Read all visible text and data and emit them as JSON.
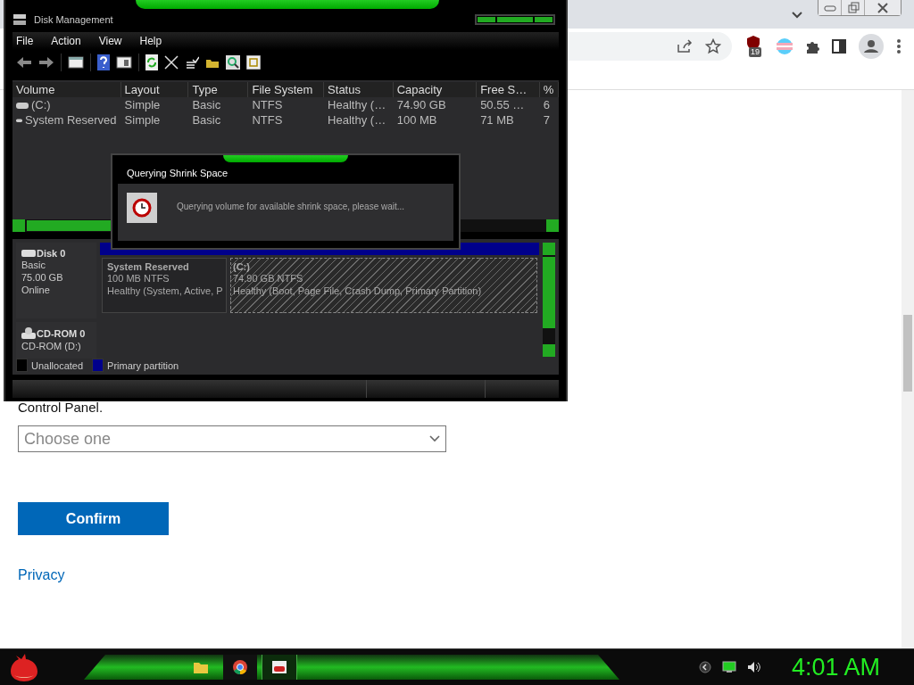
{
  "browser": {
    "extension_badge": "19"
  },
  "page": {
    "text": "Control Panel.",
    "select": {
      "placeholder": "Choose one"
    },
    "confirm_button": "Confirm",
    "privacy_link": "Privacy"
  },
  "disk_management": {
    "title": "Disk Management",
    "menu": [
      "File",
      "Action",
      "View",
      "Help"
    ],
    "columns": [
      "Volume",
      "Layout",
      "Type",
      "File System",
      "Status",
      "Capacity",
      "Free S…",
      "%"
    ],
    "rows": [
      {
        "cells": [
          "(C:)",
          "Simple",
          "Basic",
          "NTFS",
          "Healthy (…",
          "74.90 GB",
          "50.55 …",
          "6"
        ]
      },
      {
        "cells": [
          "System Reserved",
          "Simple",
          "Basic",
          "NTFS",
          "Healthy (…",
          "100 MB",
          "71 MB",
          "7"
        ]
      }
    ],
    "disks": [
      {
        "kind": "disk",
        "name": "Disk 0",
        "lines": [
          "Basic",
          "75.00 GB",
          "Online"
        ],
        "partitions": [
          {
            "title": "System Reserved",
            "size": "100 MB NTFS",
            "status": "Healthy (System, Active, P",
            "selected": false
          },
          {
            "title": "(C:)",
            "size": "74.90 GB NTFS",
            "status": "Healthy (Boot, Page File, Crash Dump, Primary Partition)",
            "selected": true
          }
        ]
      },
      {
        "kind": "cdrom",
        "name": "CD-ROM 0",
        "lines": [
          "CD-ROM (D:)"
        ]
      }
    ],
    "legend": [
      {
        "label": "Unallocated",
        "color": "#000000"
      },
      {
        "label": "Primary partition",
        "color": "#00008b"
      }
    ]
  },
  "dialog": {
    "title": "Querying Shrink Space",
    "message": "Querying volume for available shrink space, please wait..."
  },
  "taskbar": {
    "apps": [
      {
        "kind": "folder",
        "selected": false
      },
      {
        "kind": "browser",
        "selected": false
      },
      {
        "kind": "disk",
        "selected": true
      }
    ],
    "clock": "4:01 AM"
  }
}
